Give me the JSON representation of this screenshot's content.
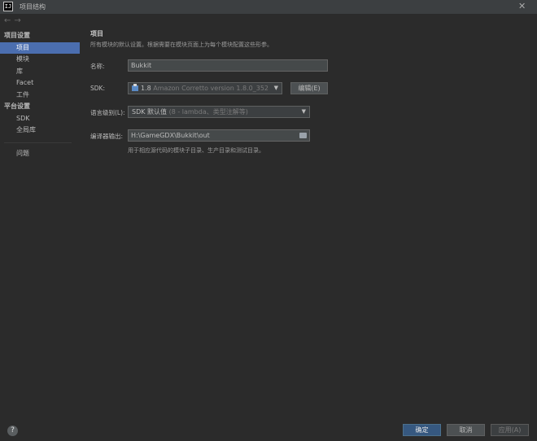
{
  "window": {
    "title": "项目结构",
    "app_icon_text": "IJ"
  },
  "nav": {
    "back": "←",
    "forward": "→"
  },
  "sidebar": {
    "sections": [
      {
        "label": "项目设置",
        "items": [
          "项目",
          "模块",
          "库",
          "Facet",
          "工件"
        ]
      },
      {
        "label": "平台设置",
        "items": [
          "SDK",
          "全局库"
        ]
      }
    ],
    "bottom_item": "问题",
    "selected": "项目"
  },
  "panel": {
    "title": "项目",
    "description": "所有模块的默认设置。根据需要在模块页面上为每个模块配置这些形参。",
    "name_label": "名称:",
    "name_value": "Bukkit",
    "sdk_label": "SDK:",
    "sdk_value": "1.8",
    "sdk_detail": "Amazon Corretto version 1.8.0_352",
    "edit_button": "编辑(E)",
    "lang_label": "语言级别(L):",
    "lang_value": "SDK 默认值",
    "lang_detail": "(8 - lambda、类型注解等)",
    "output_label": "编译器输出:",
    "output_value": "H:\\GameGDX\\Bukkit\\out",
    "output_hint": "用于相应源代码的模块子目录、生产目录和测试目录。"
  },
  "footer": {
    "help": "?",
    "ok": "确定",
    "cancel": "取消",
    "apply": "应用(A)"
  }
}
